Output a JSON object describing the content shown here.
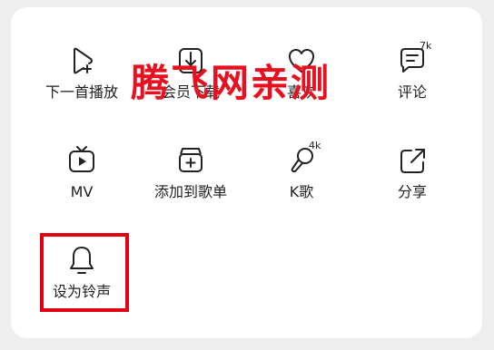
{
  "menu": {
    "row1": [
      {
        "label": "下一首播放",
        "icon": "play-next-icon"
      },
      {
        "label": "会员下载",
        "icon": "download-icon"
      },
      {
        "label": "喜欢",
        "icon": "heart-icon"
      },
      {
        "label": "评论",
        "icon": "comment-icon",
        "badge": "7k"
      }
    ],
    "row2": [
      {
        "label": "MV",
        "icon": "tv-play-icon"
      },
      {
        "label": "添加到歌单",
        "icon": "add-to-playlist-icon"
      },
      {
        "label": "K歌",
        "icon": "karaoke-mic-icon",
        "badge": "4k"
      },
      {
        "label": "分享",
        "icon": "share-icon"
      }
    ],
    "row3": [
      {
        "label": "设为铃声",
        "icon": "bell-icon"
      }
    ]
  },
  "watermark": "腾飞网亲测",
  "colors": {
    "watermark": "#e8101e",
    "highlight_box": "#e00012"
  }
}
